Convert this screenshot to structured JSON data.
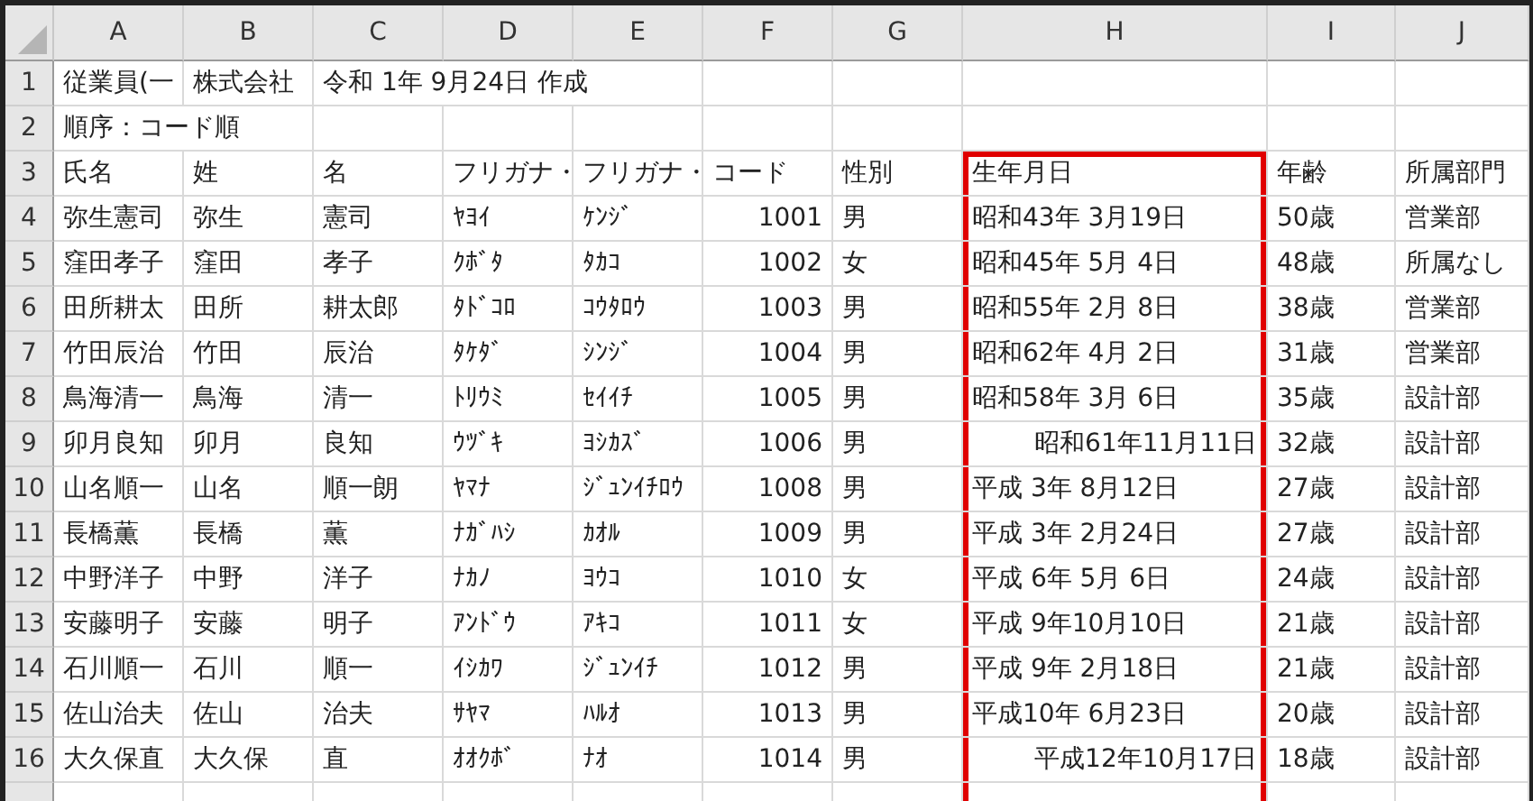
{
  "columns": [
    "A",
    "B",
    "C",
    "D",
    "E",
    "F",
    "G",
    "H",
    "I",
    "J"
  ],
  "rows": [
    {
      "number": "1",
      "cells": {
        "A": "従業員(一",
        "B": "株式会社",
        "C": "令和 1年 9月24日 作成"
      }
    },
    {
      "number": "2",
      "cells": {
        "A": "順序：コード順"
      }
    },
    {
      "number": "3",
      "cells": {
        "A": "氏名",
        "B": "姓",
        "C": "名",
        "D": "フリガナ・",
        "E": "フリガナ・",
        "F": "コード",
        "G": "性別",
        "H": {
          "text": "生年月日",
          "framed": true
        },
        "I": "年齢",
        "J": "所属部門"
      }
    },
    {
      "number": "4",
      "cells": {
        "A": "弥生憲司",
        "B": "弥生",
        "C": "憲司",
        "D": "ﾔﾖｲ",
        "E": "ｹﾝｼﾞ",
        "F": {
          "text": "1001",
          "kind": "number"
        },
        "G": "男",
        "H": {
          "text": "昭和43年 3月19日",
          "framed": true
        },
        "I": "50歳",
        "J": "営業部"
      }
    },
    {
      "number": "5",
      "cells": {
        "A": "窪田孝子",
        "B": "窪田",
        "C": "孝子",
        "D": "ｸﾎﾞﾀ",
        "E": "ﾀｶｺ",
        "F": {
          "text": "1002",
          "kind": "number"
        },
        "G": "女",
        "H": {
          "text": "昭和45年 5月 4日",
          "framed": true
        },
        "I": "48歳",
        "J": "所属なし"
      }
    },
    {
      "number": "6",
      "cells": {
        "A": "田所耕太",
        "B": "田所",
        "C": "耕太郎",
        "D": "ﾀﾄﾞｺﾛ",
        "E": "ｺｳﾀﾛｳ",
        "F": {
          "text": "1003",
          "kind": "number"
        },
        "G": "男",
        "H": {
          "text": "昭和55年 2月 8日",
          "framed": true
        },
        "I": "38歳",
        "J": "営業部"
      }
    },
    {
      "number": "7",
      "cells": {
        "A": "竹田辰治",
        "B": "竹田",
        "C": "辰治",
        "D": "ﾀｹﾀﾞ",
        "E": "ｼﾝｼﾞ",
        "F": {
          "text": "1004",
          "kind": "number"
        },
        "G": "男",
        "H": {
          "text": "昭和62年 4月 2日",
          "framed": true
        },
        "I": "31歳",
        "J": "営業部"
      }
    },
    {
      "number": "8",
      "cells": {
        "A": "鳥海清一",
        "B": "鳥海",
        "C": "清一",
        "D": "ﾄﾘｳﾐ",
        "E": "ｾｲｲﾁ",
        "F": {
          "text": "1005",
          "kind": "number"
        },
        "G": "男",
        "H": {
          "text": "昭和58年 3月 6日",
          "framed": true
        },
        "I": "35歳",
        "J": "設計部"
      }
    },
    {
      "number": "9",
      "cells": {
        "A": "卯月良知",
        "B": "卯月",
        "C": "良知",
        "D": "ｳﾂﾞｷ",
        "E": "ﾖｼｶｽﾞ",
        "F": {
          "text": "1006",
          "kind": "number"
        },
        "G": "男",
        "H": {
          "text": "昭和61年11月11日",
          "kind": "number",
          "framed": true
        },
        "I": "32歳",
        "J": "設計部"
      }
    },
    {
      "number": "10",
      "cells": {
        "A": "山名順一",
        "B": "山名",
        "C": "順一朗",
        "D": "ﾔﾏﾅ",
        "E": "ｼﾞｭﾝｲﾁﾛｳ",
        "F": {
          "text": "1008",
          "kind": "number"
        },
        "G": "男",
        "H": {
          "text": "平成 3年 8月12日",
          "framed": true
        },
        "I": "27歳",
        "J": "設計部"
      }
    },
    {
      "number": "11",
      "cells": {
        "A": "長橋薫",
        "B": "長橋",
        "C": "薫",
        "D": "ﾅｶﾞﾊｼ",
        "E": "ｶｵﾙ",
        "F": {
          "text": "1009",
          "kind": "number"
        },
        "G": "男",
        "H": {
          "text": "平成 3年 2月24日",
          "framed": true
        },
        "I": "27歳",
        "J": "設計部"
      }
    },
    {
      "number": "12",
      "cells": {
        "A": "中野洋子",
        "B": "中野",
        "C": "洋子",
        "D": "ﾅｶﾉ",
        "E": "ﾖｳｺ",
        "F": {
          "text": "1010",
          "kind": "number"
        },
        "G": "女",
        "H": {
          "text": "平成 6年 5月 6日",
          "framed": true
        },
        "I": "24歳",
        "J": "設計部"
      }
    },
    {
      "number": "13",
      "cells": {
        "A": "安藤明子",
        "B": "安藤",
        "C": "明子",
        "D": "ｱﾝﾄﾞｳ",
        "E": "ｱｷｺ",
        "F": {
          "text": "1011",
          "kind": "number"
        },
        "G": "女",
        "H": {
          "text": "平成 9年10月10日",
          "framed": true
        },
        "I": "21歳",
        "J": "設計部"
      }
    },
    {
      "number": "14",
      "cells": {
        "A": "石川順一",
        "B": "石川",
        "C": "順一",
        "D": "ｲｼｶﾜ",
        "E": "ｼﾞｭﾝｲﾁ",
        "F": {
          "text": "1012",
          "kind": "number"
        },
        "G": "男",
        "H": {
          "text": "平成 9年 2月18日",
          "framed": true
        },
        "I": "21歳",
        "J": "設計部"
      }
    },
    {
      "number": "15",
      "cells": {
        "A": "佐山治夫",
        "B": "佐山",
        "C": "治夫",
        "D": "ｻﾔﾏ",
        "E": "ﾊﾙｵ",
        "F": {
          "text": "1013",
          "kind": "number"
        },
        "G": "男",
        "H": {
          "text": "平成10年 6月23日",
          "framed": true
        },
        "I": "20歳",
        "J": "設計部"
      }
    },
    {
      "number": "16",
      "cells": {
        "A": "大久保直",
        "B": "大久保",
        "C": "直",
        "D": "ｵｵｸﾎﾞ",
        "E": "ﾅｵ",
        "F": {
          "text": "1014",
          "kind": "number"
        },
        "G": "男",
        "H": {
          "text": "平成12年10月17日",
          "kind": "number",
          "framed": true
        },
        "I": "18歳",
        "J": "設計部"
      }
    }
  ]
}
